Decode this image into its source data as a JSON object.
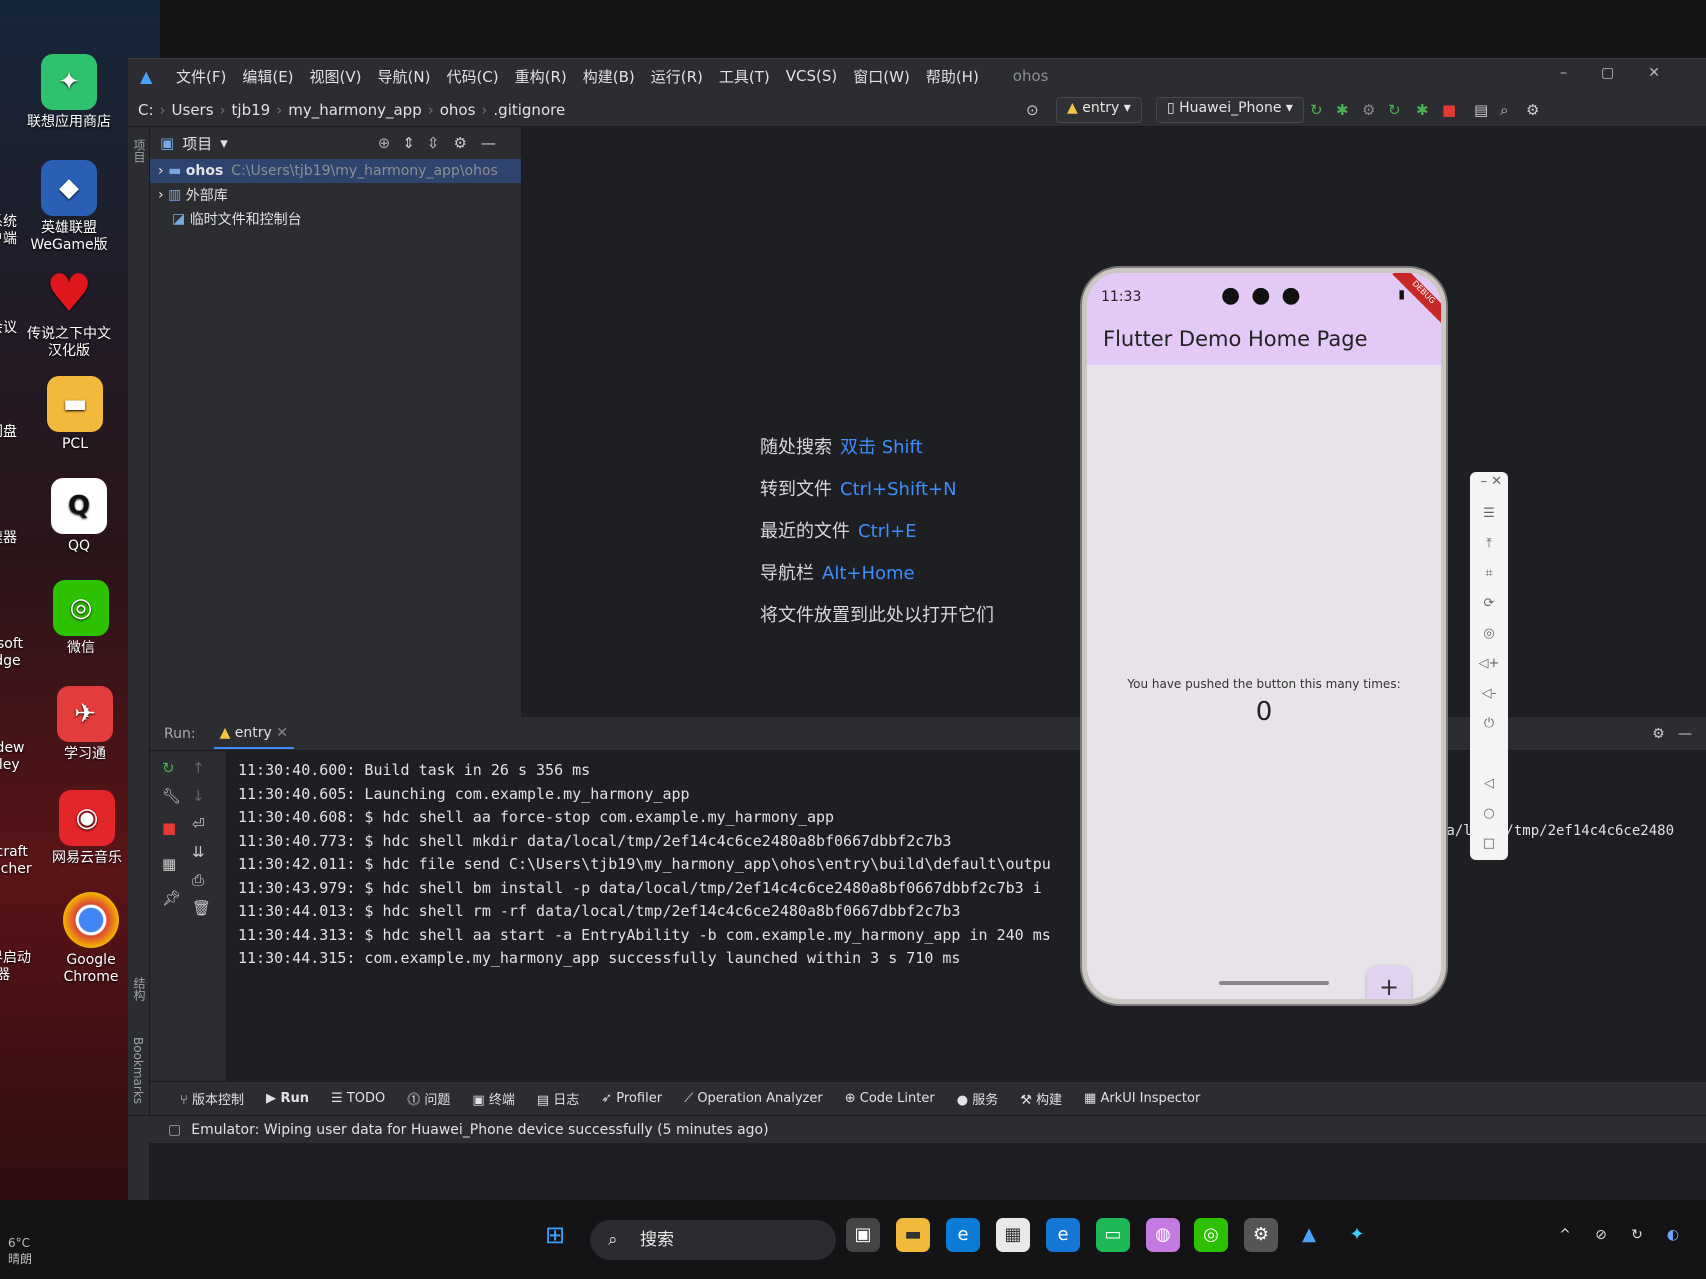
{
  "desktop": {
    "icons": [
      {
        "label": "联想应用商店",
        "icon": "store-icon",
        "color": "#2fc26e"
      },
      {
        "label": "英雄联盟\nWeGame版",
        "icon": "lol-icon",
        "color": "#2a5fb5"
      },
      {
        "label": "传说之下中文\n汉化版",
        "icon": "heart-icon",
        "color": "#e0161d"
      },
      {
        "label": "PCL",
        "icon": "folder-icon",
        "color": "#f2b93b"
      },
      {
        "label": "QQ",
        "icon": "qq-icon",
        "color": "#ffffff"
      },
      {
        "label": "微信",
        "icon": "wechat-icon",
        "color": "#2dc100"
      },
      {
        "label": "学习通",
        "icon": "xuexitong-icon",
        "color": "#e23c3c"
      },
      {
        "label": "网易云音乐",
        "icon": "netease-music-icon",
        "color": "#e2262a"
      },
      {
        "label": "Google\nChrome",
        "icon": "chrome-icon",
        "color": "#ffffff"
      }
    ],
    "clipped_icons": [
      {
        "label": "系统\n户端"
      },
      {
        "label": "会议"
      },
      {
        "label": "网盘"
      },
      {
        "label": "速器"
      },
      {
        "label": "rosoft\nEdge"
      },
      {
        "label": "ardew\nalley"
      },
      {
        "label": "necraft\nauncher"
      },
      {
        "label": "世界启动\n器"
      }
    ]
  },
  "ide": {
    "menu": [
      "文件(F)",
      "编辑(E)",
      "视图(V)",
      "导航(N)",
      "代码(C)",
      "重构(R)",
      "构建(B)",
      "运行(R)",
      "工具(T)",
      "VCS(S)",
      "窗口(W)",
      "帮助(H)"
    ],
    "project_name": "ohos",
    "breadcrumb": [
      "C:",
      "Users",
      "tjb19",
      "my_harmony_app",
      "ohos",
      ".gitignore"
    ],
    "run_config": "entry",
    "device": "Huawei_Phone",
    "left_strip_label": "项目",
    "project_panel": {
      "title": "项目",
      "tree": [
        {
          "name": "ohos",
          "path": "C:\\Users\\tjb19\\my_harmony_app\\ohos"
        },
        {
          "name": "外部库",
          "path": ""
        },
        {
          "name": "临时文件和控制台",
          "path": ""
        }
      ]
    },
    "hints": [
      {
        "label": "随处搜索",
        "key": "双击 Shift"
      },
      {
        "label": "转到文件",
        "key": "Ctrl+Shift+N"
      },
      {
        "label": "最近的文件",
        "key": "Ctrl+E"
      },
      {
        "label": "导航栏",
        "key": "Alt+Home"
      },
      {
        "label": "将文件放置到此处以打开它们",
        "key": ""
      }
    ],
    "run": {
      "label": "Run:",
      "tab": "entry",
      "lines": [
        "11:30:40.600: Build task in 26 s 356 ms",
        "11:30:40.605: Launching com.example.my_harmony_app",
        "11:30:40.608: $ hdc shell aa force-stop com.example.my_harmony_app",
        "11:30:40.773: $ hdc shell mkdir data/local/tmp/2ef14c4c6ce2480a8bf0667dbbf2c7b3",
        "11:30:42.011: $ hdc file send C:\\Users\\tjb19\\my_harmony_app\\ohos\\entry\\build\\default\\outpu",
        "11:30:43.979: $ hdc shell bm install -p data/local/tmp/2ef14c4c6ce2480a8bf0667dbbf2c7b3  i",
        "11:30:44.013: $ hdc shell rm -rf data/local/tmp/2ef14c4c6ce2480a8bf0667dbbf2c7b3",
        "11:30:44.313: $ hdc shell aa start -a EntryAbility -b com.example.my_harmony_app in 240 ms",
        "11:30:44.315: com.example.my_harmony_app successfully launched within 3 s 710 ms"
      ],
      "overflow_text": "ta/local/tmp/2ef14c4c6ce2480"
    },
    "bottom_tabs": [
      "版本控制",
      "Run",
      "TODO",
      "问题",
      "终端",
      "日志",
      "Profiler",
      "Operation Analyzer",
      "Code Linter",
      "服务",
      "构建",
      "ArkUI Inspector"
    ],
    "side_labels": [
      "结构",
      "Bookmarks"
    ],
    "status": "Emulator: Wiping user data for Huawei_Phone device successfully (5 minutes ago)"
  },
  "phone": {
    "time": "11:33",
    "debug_banner": "DEBUG",
    "app_title": "Flutter Demo Home Page",
    "counter_text": "You have pushed the button this many times:",
    "counter_value": "0",
    "fab_label": "+"
  },
  "taskbar": {
    "search_placeholder": "搜索",
    "weather": "6°C\n晴朗"
  },
  "colors": {
    "ide_bg": "#1e1f22",
    "panel_bg": "#2b2d30",
    "accent": "#3d8eff",
    "appbar": "#e3c9f5"
  }
}
